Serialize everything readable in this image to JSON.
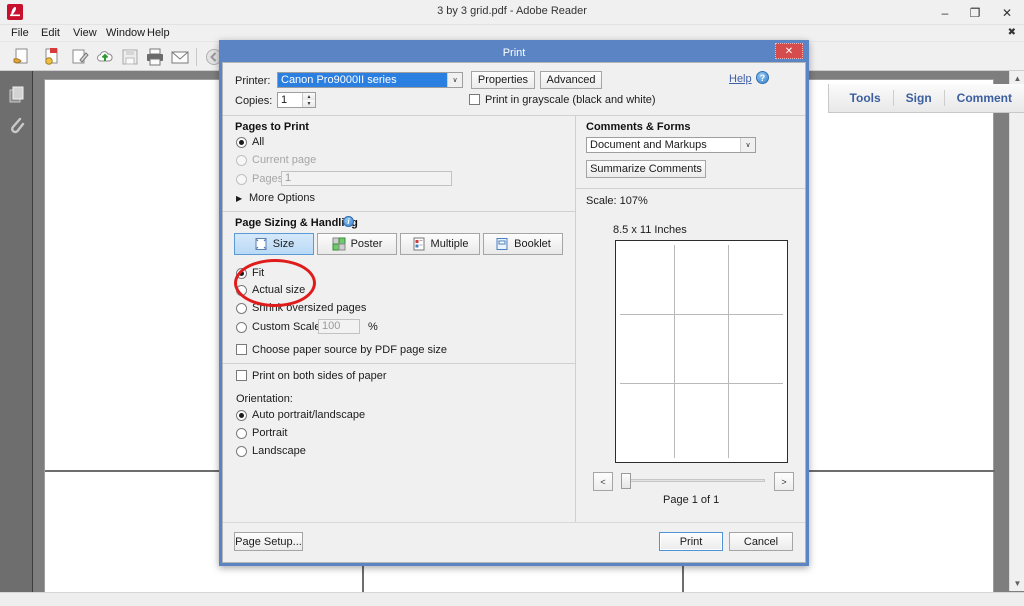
{
  "window": {
    "title": "3 by 3 grid.pdf - Adobe Reader",
    "minimize_label": "–",
    "maximize_label": "❐",
    "close_label": "✕",
    "menus": [
      "File",
      "Edit",
      "View",
      "Window",
      "Help"
    ],
    "menu_close_label": "✖",
    "right_tools": [
      "Tools",
      "Sign",
      "Comment"
    ]
  },
  "toolbar": {
    "icons": [
      "open-file-icon",
      "create-pdf-icon",
      "edit-pdf-icon",
      "upload-cloud-icon",
      "save-file-icon",
      "print-icon",
      "email-icon",
      "previous-page-icon"
    ]
  },
  "navpane": {
    "icons": [
      "page-thumbnails-icon",
      "attachments-icon"
    ]
  },
  "dialog": {
    "title": "Print",
    "close_label": "✕",
    "printer": {
      "label": "Printer:",
      "value": "Canon Pro9000II series",
      "dropdown_arrow": "∨",
      "properties_label": "Properties",
      "advanced_label": "Advanced"
    },
    "copies": {
      "label": "Copies:",
      "value": "1",
      "up_arrow": "▲",
      "down_arrow": "▼"
    },
    "grayscale": {
      "label": "Print in grayscale (black and white)",
      "checked": false
    },
    "help": {
      "label": "Help",
      "icon_glyph": "?"
    },
    "pages_to_print": {
      "header": "Pages to Print",
      "options": [
        {
          "label": "All",
          "selected": true,
          "disabled": false
        },
        {
          "label": "Current page",
          "selected": false,
          "disabled": true
        },
        {
          "label": "Pages",
          "selected": false,
          "disabled": true
        }
      ],
      "pages_value": "1",
      "more_options_label": "More Options",
      "more_options_arrow": "▶"
    },
    "page_sizing": {
      "header": "Page Sizing & Handling",
      "info_icon_glyph": "i",
      "modes": [
        {
          "label": "Size",
          "active": true
        },
        {
          "label": "Poster",
          "active": false
        },
        {
          "label": "Multiple",
          "active": false
        },
        {
          "label": "Booklet",
          "active": false
        }
      ],
      "scale_options": [
        {
          "label": "Fit",
          "selected": true
        },
        {
          "label": "Actual size",
          "selected": false
        },
        {
          "label": "Shrink oversized pages",
          "selected": false
        },
        {
          "label": "Custom Scale:",
          "selected": false
        }
      ],
      "custom_scale_value": "100",
      "percent_label": "%",
      "paper_source_label": "Choose paper source by PDF page size",
      "paper_source_checked": false
    },
    "duplex": {
      "label": "Print on both sides of paper",
      "checked": false
    },
    "orientation": {
      "label": "Orientation:",
      "options": [
        {
          "label": "Auto portrait/landscape",
          "selected": true
        },
        {
          "label": "Portrait",
          "selected": false
        },
        {
          "label": "Landscape",
          "selected": false
        }
      ]
    },
    "comments_forms": {
      "header": "Comments & Forms",
      "value": "Document and Markups",
      "dropdown_arrow": "∨",
      "summarize_label": "Summarize Comments"
    },
    "preview": {
      "scale_label": "Scale: 107%",
      "paper_size_label": "8.5 x 11 Inches",
      "page_indicator": "Page 1 of 1",
      "prev_label": "<",
      "next_label": ">"
    },
    "footer": {
      "page_setup_label": "Page Setup...",
      "print_label": "Print",
      "cancel_label": "Cancel"
    }
  },
  "annotation": {
    "shape": "red-ellipse",
    "color": "#e01b1b",
    "targets": [
      "Fit",
      "Actual size"
    ]
  },
  "colors": {
    "dialog_frame": "#5b84c4",
    "accent_blue": "#2a7fe0",
    "annotation_red": "#e01b1b",
    "doc_background": "#7e7e7e"
  }
}
